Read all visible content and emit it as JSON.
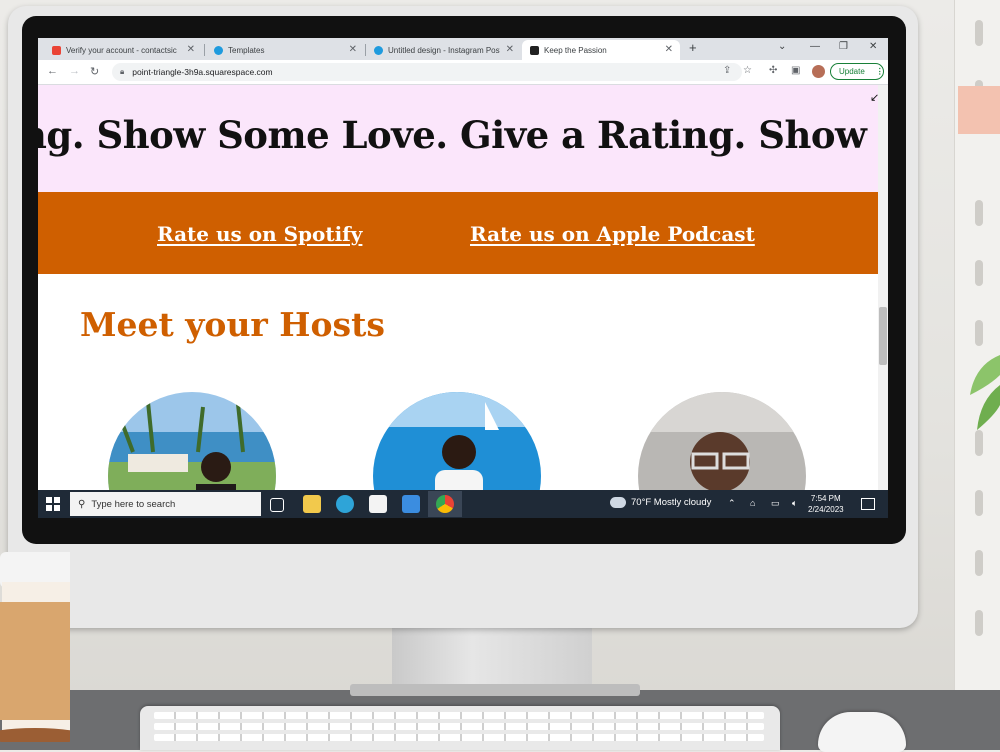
{
  "browser": {
    "tabs": [
      {
        "title": "Verify your account - contactsic",
        "icon": "gmail-icon",
        "color": "#ea4335"
      },
      {
        "title": "Templates",
        "icon": "canva-icon",
        "color": "#1f9bde"
      },
      {
        "title": "Untitled design - Instagram Post",
        "icon": "canva-icon",
        "color": "#1f9bde"
      },
      {
        "title": "Keep the Passion",
        "icon": "squarespace-icon",
        "color": "#222222"
      }
    ],
    "active_tab": 3,
    "new_tab": "+",
    "url": "point-triangle-3h9a.squarespace.com",
    "update_label": "Update"
  },
  "page": {
    "marquee_text": "ng.  Show Some Love.  Give a Rating.  Show S",
    "rate_spotify": "Rate us on Spotify",
    "rate_apple": "Rate us on Apple Podcast",
    "hosts_title": "Meet your Hosts",
    "colors": {
      "pink": "#fbe6fb",
      "orange": "#cf5f00",
      "text": "#111111"
    }
  },
  "taskbar": {
    "search_placeholder": "Type here to search",
    "weather": "70°F  Mostly cloudy",
    "time": "7:54 PM",
    "date": "2/24/2023"
  }
}
